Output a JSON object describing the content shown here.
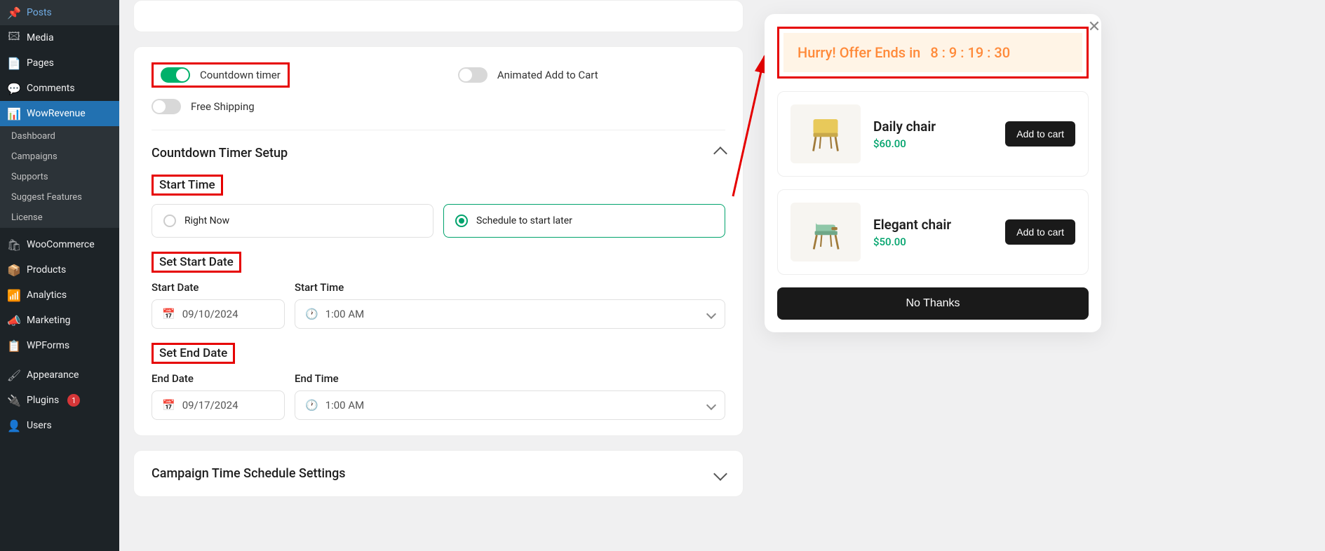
{
  "sidebar": {
    "items": [
      {
        "icon": "pin",
        "label": "Posts"
      },
      {
        "icon": "media",
        "label": "Media"
      },
      {
        "icon": "page",
        "label": "Pages"
      },
      {
        "icon": "comment",
        "label": "Comments"
      },
      {
        "icon": "chart",
        "label": "WowRevenue"
      },
      {
        "icon": "wc",
        "label": "WooCommerce"
      },
      {
        "icon": "box",
        "label": "Products"
      },
      {
        "icon": "bars",
        "label": "Analytics"
      },
      {
        "icon": "mega",
        "label": "Marketing"
      },
      {
        "icon": "form",
        "label": "WPForms"
      },
      {
        "icon": "brush",
        "label": "Appearance"
      },
      {
        "icon": "plug",
        "label": "Plugins"
      },
      {
        "icon": "user",
        "label": "Users"
      }
    ],
    "submenu": [
      "Dashboard",
      "Campaigns",
      "Supports",
      "Suggest Features",
      "License"
    ],
    "plugins_count": "1"
  },
  "toggles": {
    "countdown": {
      "label": "Countdown timer",
      "on": true
    },
    "animated": {
      "label": "Animated Add to Cart",
      "on": false
    },
    "freeship": {
      "label": "Free Shipping",
      "on": false
    }
  },
  "section_title": "Countdown Timer Setup",
  "start_time": {
    "label": "Start Time",
    "right_now": "Right Now",
    "schedule": "Schedule to start later"
  },
  "set_start": {
    "label": "Set Start Date",
    "date_label": "Start Date",
    "time_label": "Start Time",
    "date": "09/10/2024",
    "time": "1:00 AM"
  },
  "set_end": {
    "label": "Set End Date",
    "date_label": "End Date",
    "time_label": "End Time",
    "date": "09/17/2024",
    "time": "1:00 AM"
  },
  "schedule_settings": "Campaign Time Schedule Settings",
  "preview": {
    "hurry": "Hurry! Offer Ends in",
    "timer": "8 : 9 : 19 : 30",
    "products": [
      {
        "name": "Daily chair",
        "price": "$60.00",
        "cart": "Add to cart"
      },
      {
        "name": "Elegant chair",
        "price": "$50.00",
        "cart": "Add to cart"
      }
    ],
    "no_thanks": "No Thanks"
  }
}
